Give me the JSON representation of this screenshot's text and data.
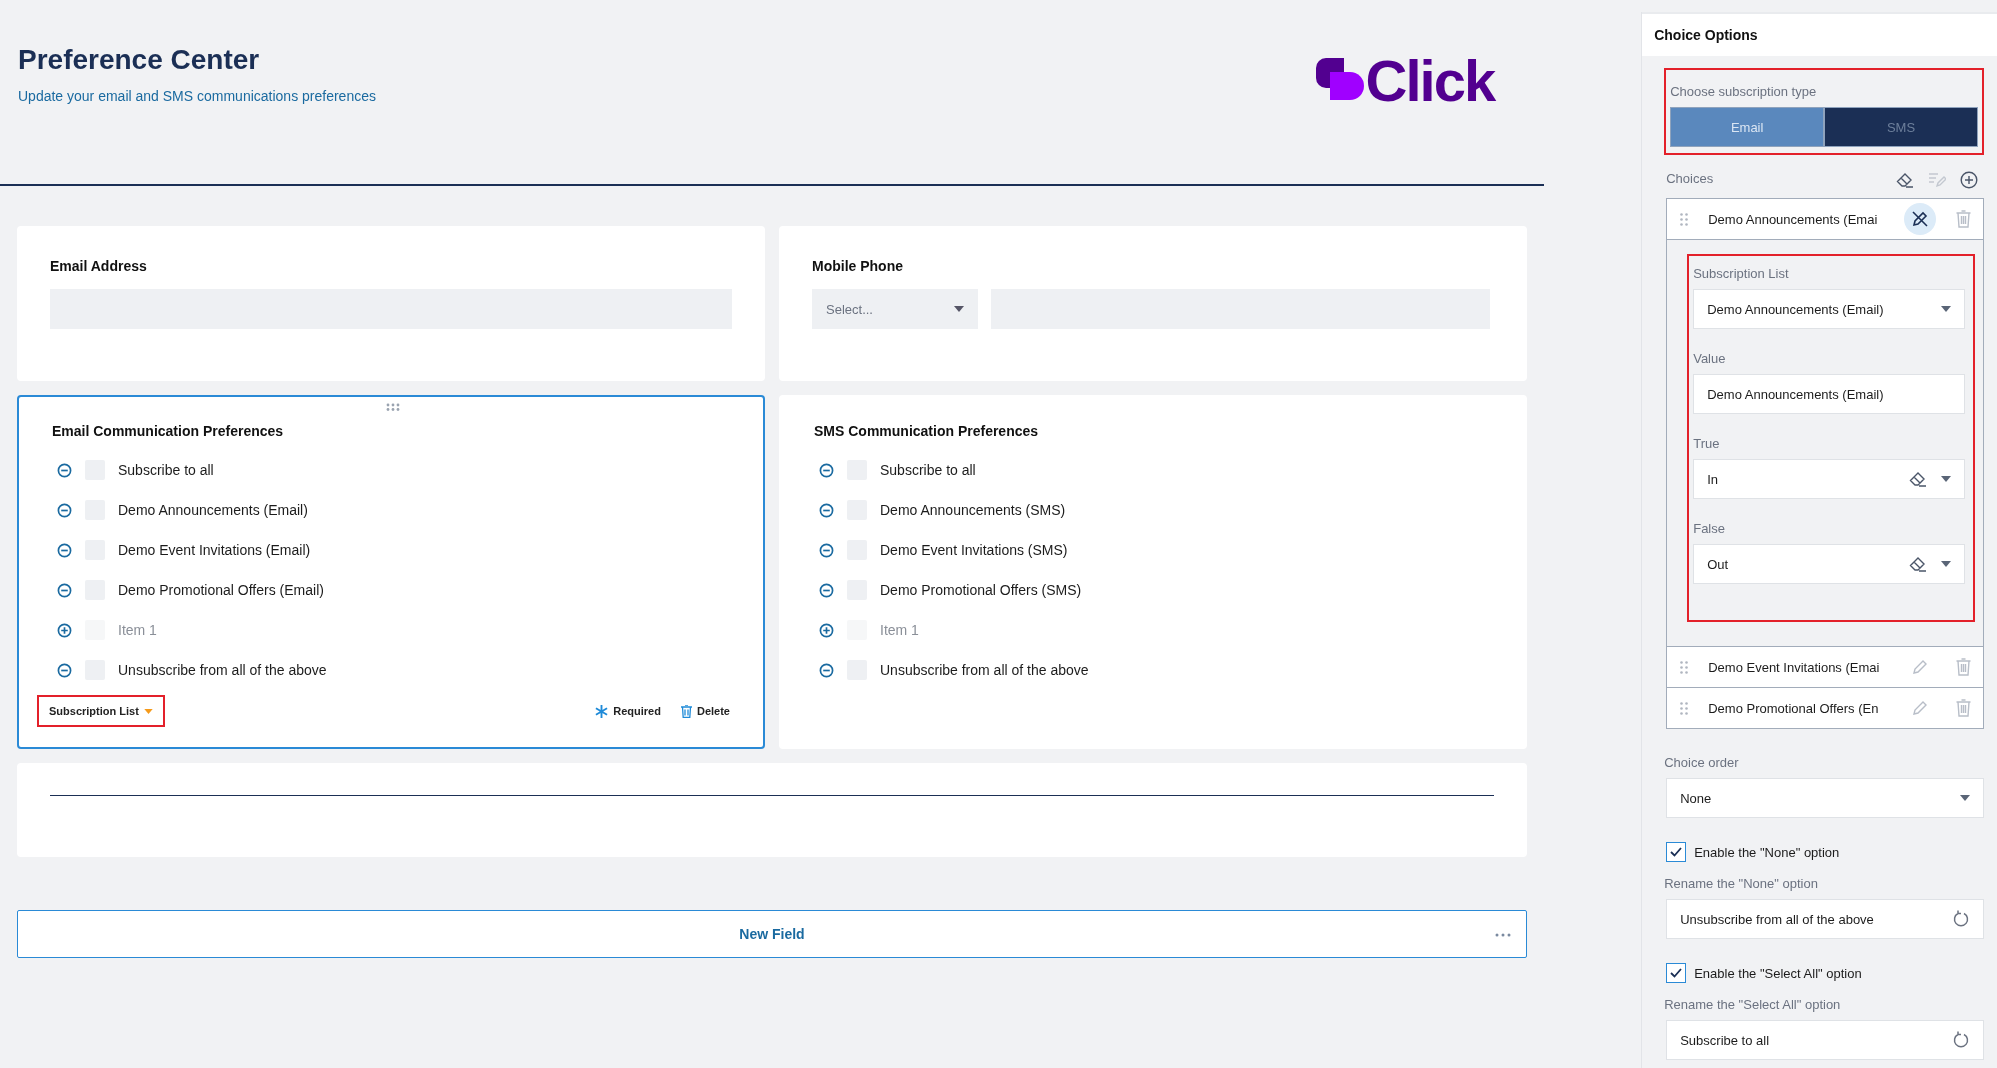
{
  "header": {
    "title": "Preference Center",
    "subtitle": "Update your email and SMS communications preferences"
  },
  "logo": {
    "text": "Click"
  },
  "contact_fields": [
    {
      "label": "Email Address",
      "kind": "text"
    },
    {
      "label": "Mobile Phone",
      "kind": "phone",
      "placeholder": "Select..."
    }
  ],
  "preference_groups": [
    {
      "title": "Email Communication Preferences",
      "selected": true,
      "items": [
        {
          "label": "Subscribe to all",
          "kind": "choice"
        },
        {
          "label": "Demo Announcements (Email)",
          "kind": "choice"
        },
        {
          "label": "Demo Event Invitations (Email)",
          "kind": "choice"
        },
        {
          "label": "Demo Promotional Offers (Email)",
          "kind": "choice"
        },
        {
          "label": "Item 1",
          "kind": "add"
        },
        {
          "label": "Unsubscribe from all of the above",
          "kind": "choice"
        }
      ],
      "footer": {
        "type_label": "Subscription List",
        "required": "Required",
        "delete": "Delete"
      }
    },
    {
      "title": "SMS Communication Preferences",
      "selected": false,
      "items": [
        {
          "label": "Subscribe to all",
          "kind": "choice"
        },
        {
          "label": "Demo Announcements (SMS)",
          "kind": "choice"
        },
        {
          "label": "Demo Event Invitations (SMS)",
          "kind": "choice"
        },
        {
          "label": "Demo Promotional Offers (SMS)",
          "kind": "choice"
        },
        {
          "label": "Item 1",
          "kind": "add"
        },
        {
          "label": "Unsubscribe from all of the above",
          "kind": "choice"
        }
      ]
    }
  ],
  "new_field": {
    "label": "New Field"
  },
  "panel": {
    "title": "Choice Options",
    "subscription_type": {
      "label": "Choose subscription type",
      "options": [
        {
          "label": "Email",
          "selected": true
        },
        {
          "label": "SMS",
          "selected": false
        }
      ]
    },
    "choices": {
      "label": "Choices",
      "items": [
        {
          "label": "Demo Announcements (Emai",
          "expanded": true,
          "fields": [
            {
              "label": "Subscription List",
              "value": "Demo Announcements (Email)",
              "kind": "dropdown"
            },
            {
              "label": "Value",
              "value": "Demo Announcements (Email)",
              "kind": "text"
            },
            {
              "label": "True",
              "value": "In",
              "kind": "clearable"
            },
            {
              "label": "False",
              "value": "Out",
              "kind": "clearable"
            }
          ]
        },
        {
          "label": "Demo Event Invitations (Emai",
          "expanded": false
        },
        {
          "label": "Demo Promotional Offers (En",
          "expanded": false
        }
      ]
    },
    "choice_order": {
      "label": "Choice order",
      "value": "None"
    },
    "options": [
      {
        "kind": "checkbox",
        "label": "Enable the \"None\" option",
        "checked": true
      },
      {
        "kind": "text",
        "label": "Rename the \"None\" option",
        "value": "Unsubscribe from all of the above"
      },
      {
        "kind": "checkbox",
        "label": "Enable the \"Select All\" option",
        "checked": true
      },
      {
        "kind": "text",
        "label": "Rename the \"Select All\" option",
        "value": "Subscribe to all"
      }
    ]
  }
}
